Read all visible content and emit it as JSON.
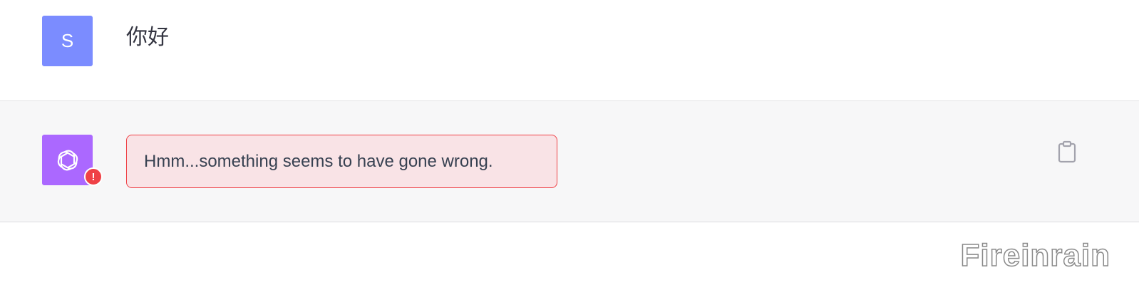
{
  "user_message": {
    "avatar_initial": "S",
    "avatar_color": "#7b8cff",
    "text": "你好"
  },
  "assistant_message": {
    "avatar_icon": "openai-logo-icon",
    "avatar_color": "#ab68ff",
    "error_badge": "!",
    "error_text": "Hmm...something seems to have gone wrong.",
    "error_border_color": "#ef4146",
    "error_bg_color": "#f9e3e6",
    "copy_icon": "clipboard-icon"
  },
  "watermark": {
    "text": "Fireinrain"
  }
}
